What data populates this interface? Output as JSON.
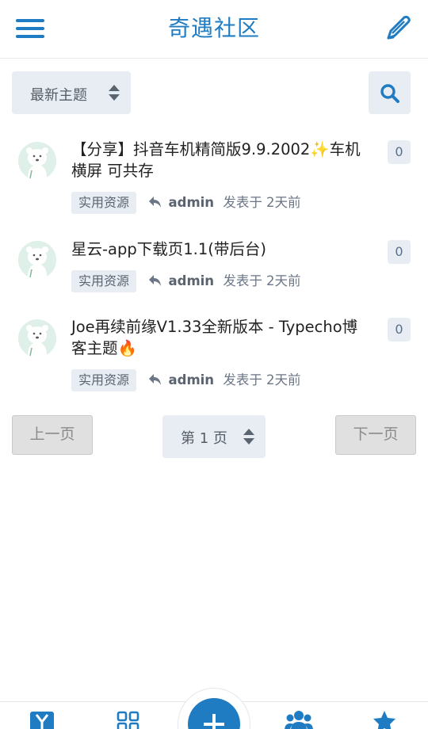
{
  "header": {
    "title": "奇遇社区",
    "menu_icon": "hamburger-menu-icon",
    "edit_icon": "pen-icon"
  },
  "toolbar": {
    "sort_label": "最新主题",
    "search_icon": "search-icon"
  },
  "topics": [
    {
      "title": "【分享】抖音车机精简版9.9.2002",
      "title_emoji": "✨",
      "title_after": "车机横屏 可共存",
      "replies": "0",
      "tag": "实用资源",
      "author": "admin",
      "posted": "发表于 2天前"
    },
    {
      "title": "星云-app下载页1.1(带后台)",
      "title_emoji": "",
      "title_after": "",
      "replies": "0",
      "tag": "实用资源",
      "author": "admin",
      "posted": "发表于 2天前"
    },
    {
      "title": "Joe再续前缘V1.33全新版本 - Typecho博客主题",
      "title_emoji": "🔥",
      "title_after": "",
      "replies": "0",
      "tag": "实用资源",
      "author": "admin",
      "posted": "发表于 2天前"
    }
  ],
  "pager": {
    "prev_label": "上一页",
    "page_label": "第 1 页",
    "next_label": "下一页"
  },
  "bottom_nav": {
    "items": [
      "home-logo-icon",
      "categories-grid-icon",
      "new-topic-plus-icon",
      "users-icon",
      "star-icon"
    ]
  },
  "colors": {
    "accent": "#1f7cc2",
    "chip_bg": "#e8edf3"
  }
}
